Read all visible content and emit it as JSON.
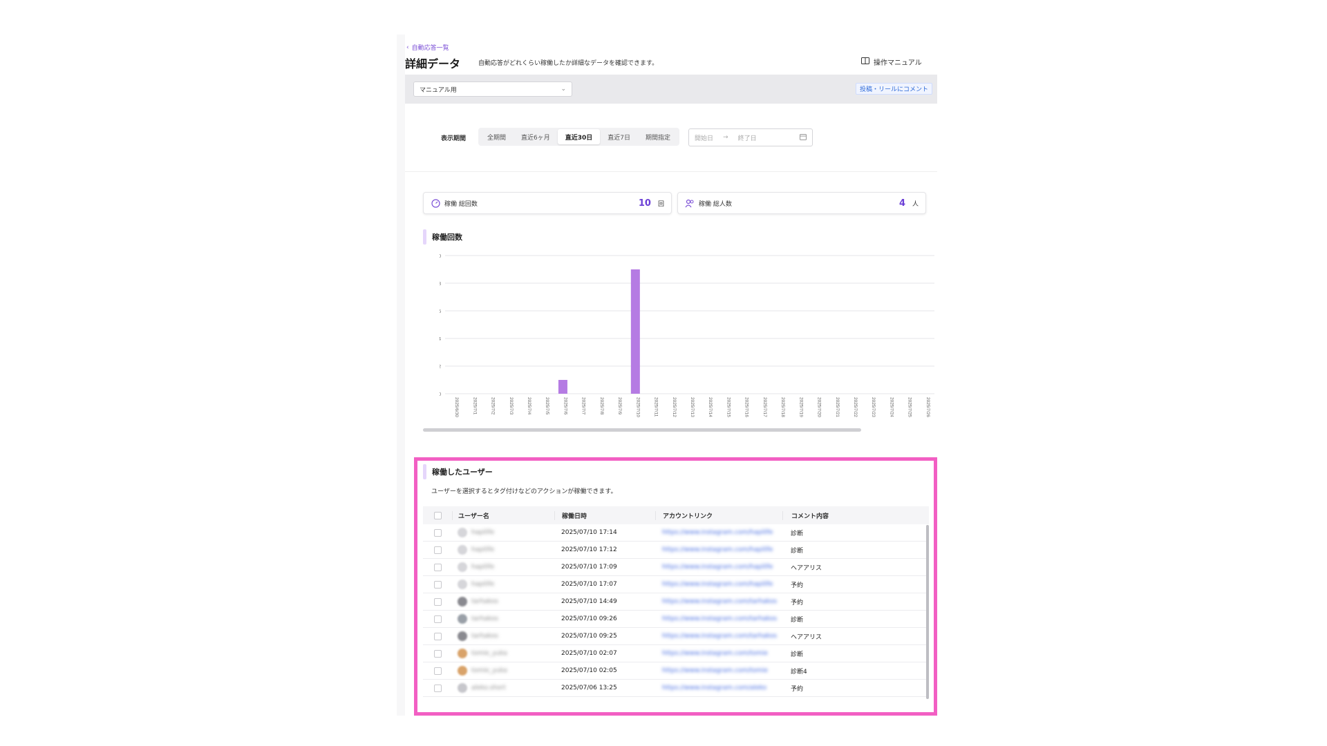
{
  "header": {
    "back_link": "自動応答一覧",
    "title": "詳細データ",
    "description": "自動応答がどれくらい稼働したか詳細なデータを確認できます。",
    "manual_link": "操作マニュアル"
  },
  "filter": {
    "select_value": "マニュアル用",
    "post_reel_button": "投稿・リールにコメント"
  },
  "period": {
    "label": "表示期間",
    "tabs": [
      "全期間",
      "直近6ヶ月",
      "直近30日",
      "直近7日",
      "期間指定"
    ],
    "active_index": 2,
    "start_placeholder": "開始日",
    "end_placeholder": "終了日"
  },
  "stats": [
    {
      "label": "稼働 総回数",
      "value": "10",
      "unit": "回",
      "icon": "gauge-icon"
    },
    {
      "label": "稼働 総人数",
      "value": "4",
      "unit": "人",
      "icon": "users-icon"
    }
  ],
  "chart_section_title": "稼働回数",
  "chart_data": {
    "type": "bar",
    "title": "稼働回数",
    "ylim": [
      0,
      10
    ],
    "yticks": [
      0,
      2,
      4,
      6,
      8,
      10
    ],
    "categories": [
      "2025/6/30",
      "2025/7/1",
      "2025/7/2",
      "2025/7/3",
      "2025/7/4",
      "2025/7/5",
      "2025/7/6",
      "2025/7/7",
      "2025/7/8",
      "2025/7/9",
      "2025/7/10",
      "2025/7/11",
      "2025/7/12",
      "2025/7/13",
      "2025/7/14",
      "2025/7/15",
      "2025/7/16",
      "2025/7/17",
      "2025/7/18",
      "2025/7/19",
      "2025/7/20",
      "2025/7/21",
      "2025/7/22",
      "2025/7/23",
      "2025/7/24",
      "2025/7/25",
      "2025/7/26"
    ],
    "values": [
      0,
      0,
      0,
      0,
      0,
      0,
      1,
      0,
      0,
      0,
      9,
      0,
      0,
      0,
      0,
      0,
      0,
      0,
      0,
      0,
      0,
      0,
      0,
      0,
      0,
      0,
      0
    ],
    "color": "#b57be3"
  },
  "users": {
    "title": "稼働したユーザー",
    "description": "ユーザーを選択するとタグ付けなどのアクションが稼働できます。",
    "columns": [
      "ユーザー名",
      "稼働日時",
      "アカウントリンク",
      "コメント内容"
    ],
    "rows": [
      {
        "user": "hapilife",
        "date": "2025/07/10 17:14",
        "link": "https://www.instagram.com/hapilife",
        "comment": "診断"
      },
      {
        "user": "hapilife",
        "date": "2025/07/10 17:12",
        "link": "https://www.instagram.com/hapilife",
        "comment": "診断"
      },
      {
        "user": "hapilife",
        "date": "2025/07/10 17:09",
        "link": "https://www.instagram.com/hapilife",
        "comment": "ヘアアリス"
      },
      {
        "user": "hapilife",
        "date": "2025/07/10 17:07",
        "link": "https://www.instagram.com/hapilife",
        "comment": "予約"
      },
      {
        "user": "tarhakos",
        "date": "2025/07/10 14:49",
        "link": "https://www.instagram.com/tarhakos",
        "comment": "予約"
      },
      {
        "user": "tarhakos",
        "date": "2025/07/10 09:26",
        "link": "https://www.instagram.com/tarhakos",
        "comment": "診断"
      },
      {
        "user": "tarhakos",
        "date": "2025/07/10 09:25",
        "link": "https://www.instagram.com/tarhakos",
        "comment": "ヘアアリス"
      },
      {
        "user": "tomie_yuka",
        "date": "2025/07/10 02:07",
        "link": "https://www.instagram.com/tomie",
        "comment": "診断"
      },
      {
        "user": "tomie_yuka",
        "date": "2025/07/10 02:05",
        "link": "https://www.instagram.com/tomie",
        "comment": "診断4"
      },
      {
        "user": "aleko.short",
        "date": "2025/07/06 13:25",
        "link": "https://www.instagram.com/aleko",
        "comment": "予約"
      }
    ]
  }
}
